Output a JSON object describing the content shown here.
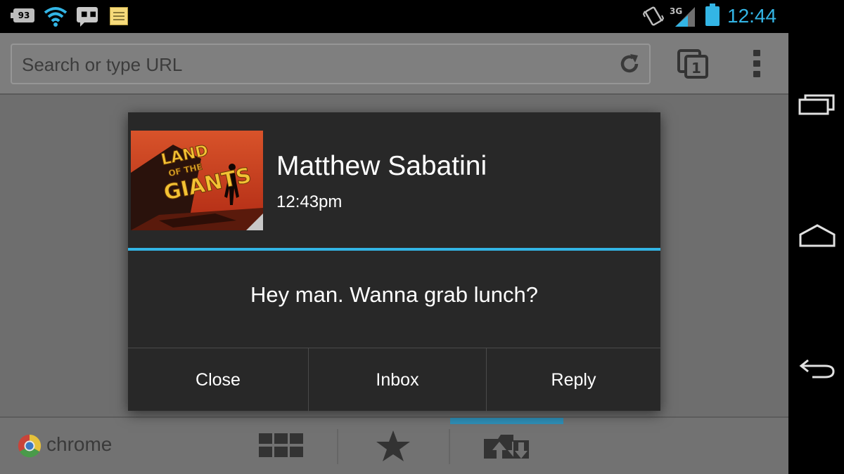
{
  "status_bar": {
    "notification_count": "93",
    "time": "12:44",
    "network_type": "3G",
    "icons": [
      "notification-badge-icon",
      "wifi-icon",
      "message-icon",
      "notes-icon",
      "vibrate-icon",
      "signal-icon",
      "battery-icon"
    ],
    "accent_color": "#33b5e5"
  },
  "browser": {
    "url_placeholder": "Search or type URL",
    "tab_count": "1",
    "brand_label": "chrome"
  },
  "dialog": {
    "sender": "Matthew Sabatini",
    "time": "12:43pm",
    "avatar_text_lines": [
      "LAND",
      "OF THE",
      "GIANTS"
    ],
    "message": "Hey man. Wanna grab lunch?",
    "buttons": {
      "close": "Close",
      "inbox": "Inbox",
      "reply": "Reply"
    }
  },
  "navbar": {
    "icons": [
      "recent-apps-icon",
      "home-icon",
      "back-icon"
    ]
  }
}
